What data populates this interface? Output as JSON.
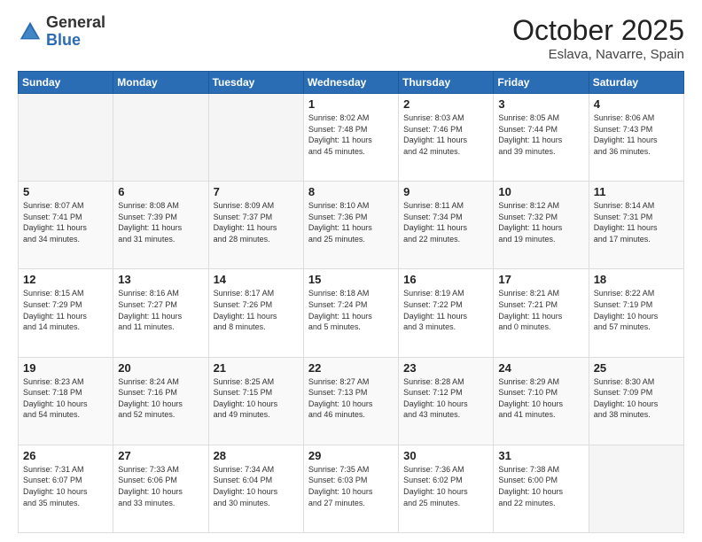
{
  "header": {
    "logo_general": "General",
    "logo_blue": "Blue",
    "title": "October 2025",
    "subtitle": "Eslava, Navarre, Spain"
  },
  "calendar": {
    "days_of_week": [
      "Sunday",
      "Monday",
      "Tuesday",
      "Wednesday",
      "Thursday",
      "Friday",
      "Saturday"
    ],
    "weeks": [
      [
        {
          "day": "",
          "info": ""
        },
        {
          "day": "",
          "info": ""
        },
        {
          "day": "",
          "info": ""
        },
        {
          "day": "1",
          "info": "Sunrise: 8:02 AM\nSunset: 7:48 PM\nDaylight: 11 hours\nand 45 minutes."
        },
        {
          "day": "2",
          "info": "Sunrise: 8:03 AM\nSunset: 7:46 PM\nDaylight: 11 hours\nand 42 minutes."
        },
        {
          "day": "3",
          "info": "Sunrise: 8:05 AM\nSunset: 7:44 PM\nDaylight: 11 hours\nand 39 minutes."
        },
        {
          "day": "4",
          "info": "Sunrise: 8:06 AM\nSunset: 7:43 PM\nDaylight: 11 hours\nand 36 minutes."
        }
      ],
      [
        {
          "day": "5",
          "info": "Sunrise: 8:07 AM\nSunset: 7:41 PM\nDaylight: 11 hours\nand 34 minutes."
        },
        {
          "day": "6",
          "info": "Sunrise: 8:08 AM\nSunset: 7:39 PM\nDaylight: 11 hours\nand 31 minutes."
        },
        {
          "day": "7",
          "info": "Sunrise: 8:09 AM\nSunset: 7:37 PM\nDaylight: 11 hours\nand 28 minutes."
        },
        {
          "day": "8",
          "info": "Sunrise: 8:10 AM\nSunset: 7:36 PM\nDaylight: 11 hours\nand 25 minutes."
        },
        {
          "day": "9",
          "info": "Sunrise: 8:11 AM\nSunset: 7:34 PM\nDaylight: 11 hours\nand 22 minutes."
        },
        {
          "day": "10",
          "info": "Sunrise: 8:12 AM\nSunset: 7:32 PM\nDaylight: 11 hours\nand 19 minutes."
        },
        {
          "day": "11",
          "info": "Sunrise: 8:14 AM\nSunset: 7:31 PM\nDaylight: 11 hours\nand 17 minutes."
        }
      ],
      [
        {
          "day": "12",
          "info": "Sunrise: 8:15 AM\nSunset: 7:29 PM\nDaylight: 11 hours\nand 14 minutes."
        },
        {
          "day": "13",
          "info": "Sunrise: 8:16 AM\nSunset: 7:27 PM\nDaylight: 11 hours\nand 11 minutes."
        },
        {
          "day": "14",
          "info": "Sunrise: 8:17 AM\nSunset: 7:26 PM\nDaylight: 11 hours\nand 8 minutes."
        },
        {
          "day": "15",
          "info": "Sunrise: 8:18 AM\nSunset: 7:24 PM\nDaylight: 11 hours\nand 5 minutes."
        },
        {
          "day": "16",
          "info": "Sunrise: 8:19 AM\nSunset: 7:22 PM\nDaylight: 11 hours\nand 3 minutes."
        },
        {
          "day": "17",
          "info": "Sunrise: 8:21 AM\nSunset: 7:21 PM\nDaylight: 11 hours\nand 0 minutes."
        },
        {
          "day": "18",
          "info": "Sunrise: 8:22 AM\nSunset: 7:19 PM\nDaylight: 10 hours\nand 57 minutes."
        }
      ],
      [
        {
          "day": "19",
          "info": "Sunrise: 8:23 AM\nSunset: 7:18 PM\nDaylight: 10 hours\nand 54 minutes."
        },
        {
          "day": "20",
          "info": "Sunrise: 8:24 AM\nSunset: 7:16 PM\nDaylight: 10 hours\nand 52 minutes."
        },
        {
          "day": "21",
          "info": "Sunrise: 8:25 AM\nSunset: 7:15 PM\nDaylight: 10 hours\nand 49 minutes."
        },
        {
          "day": "22",
          "info": "Sunrise: 8:27 AM\nSunset: 7:13 PM\nDaylight: 10 hours\nand 46 minutes."
        },
        {
          "day": "23",
          "info": "Sunrise: 8:28 AM\nSunset: 7:12 PM\nDaylight: 10 hours\nand 43 minutes."
        },
        {
          "day": "24",
          "info": "Sunrise: 8:29 AM\nSunset: 7:10 PM\nDaylight: 10 hours\nand 41 minutes."
        },
        {
          "day": "25",
          "info": "Sunrise: 8:30 AM\nSunset: 7:09 PM\nDaylight: 10 hours\nand 38 minutes."
        }
      ],
      [
        {
          "day": "26",
          "info": "Sunrise: 7:31 AM\nSunset: 6:07 PM\nDaylight: 10 hours\nand 35 minutes."
        },
        {
          "day": "27",
          "info": "Sunrise: 7:33 AM\nSunset: 6:06 PM\nDaylight: 10 hours\nand 33 minutes."
        },
        {
          "day": "28",
          "info": "Sunrise: 7:34 AM\nSunset: 6:04 PM\nDaylight: 10 hours\nand 30 minutes."
        },
        {
          "day": "29",
          "info": "Sunrise: 7:35 AM\nSunset: 6:03 PM\nDaylight: 10 hours\nand 27 minutes."
        },
        {
          "day": "30",
          "info": "Sunrise: 7:36 AM\nSunset: 6:02 PM\nDaylight: 10 hours\nand 25 minutes."
        },
        {
          "day": "31",
          "info": "Sunrise: 7:38 AM\nSunset: 6:00 PM\nDaylight: 10 hours\nand 22 minutes."
        },
        {
          "day": "",
          "info": ""
        }
      ]
    ]
  }
}
